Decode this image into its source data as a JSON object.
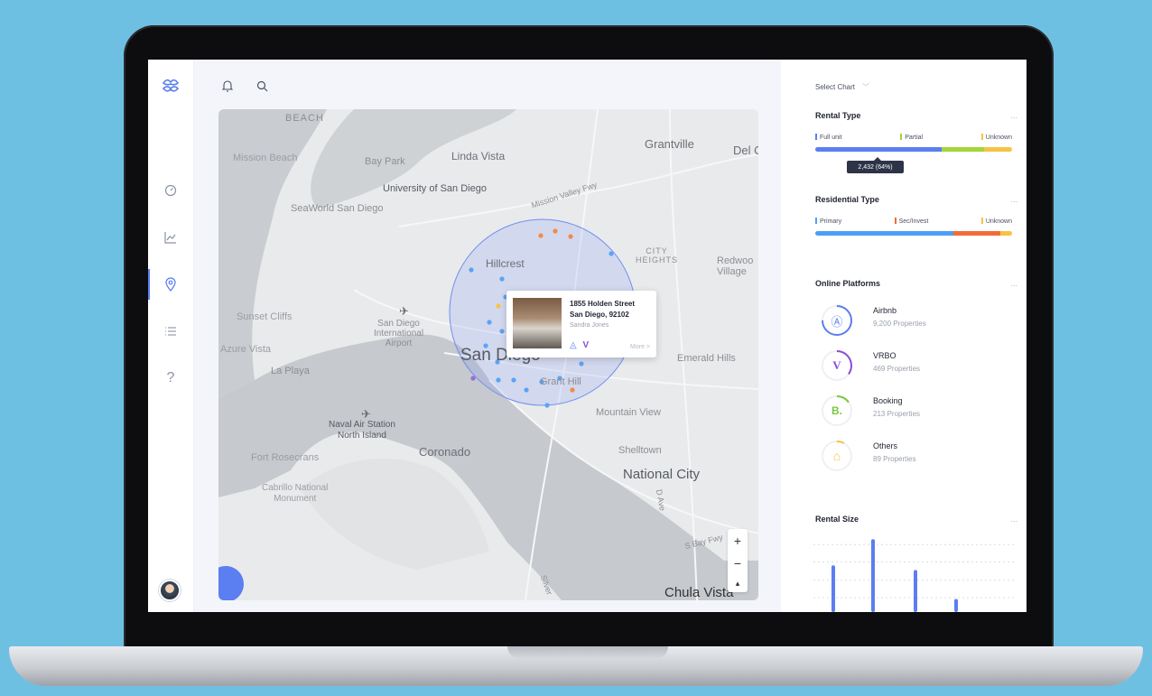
{
  "colors": {
    "accent": "#5b7ef0",
    "full_unit": "#5b7ef0",
    "partial": "#a4d53a",
    "unknown": "#f6c343",
    "primary": "#4d9ef5",
    "sec_invest": "#f26b3a",
    "airbnb": "#5b7ef0",
    "vrbo": "#8c4dd8",
    "booking": "#7cc642",
    "others": "#f6c343"
  },
  "sidebar": {
    "items": [
      {
        "icon": "logo-icon"
      },
      {
        "icon": "dashboard-gauge-icon"
      },
      {
        "icon": "line-chart-icon"
      },
      {
        "icon": "map-pin-icon",
        "active": true
      },
      {
        "icon": "list-icon"
      },
      {
        "icon": "help-icon",
        "glyph": "?"
      }
    ]
  },
  "topbar": {
    "icons": [
      "bell-icon",
      "search-icon"
    ]
  },
  "map": {
    "labels": {
      "beach": "BEACH",
      "mission_beach": "Mission Beach",
      "bay_park": "Bay Park",
      "linda_vista": "Linda Vista",
      "grantville": "Grantville",
      "del": "Del C",
      "university": "University of San Diego",
      "mission_valley_fwy": "Mission Valley Fwy",
      "seaworld": "SeaWorld San Diego",
      "city_heights": "CITY\nHEIGHTS",
      "hillcrest": "Hillcrest",
      "redwood_village": "Redwoo\nVillage",
      "sunset_cliffs": "Sunset Cliffs",
      "airport": "San Diego\nInternational\nAirport",
      "azure_vista": "Azure Vista",
      "san_diego": "San Diego",
      "emerald_hills": "Emerald Hills",
      "la_playa": "La Playa",
      "grant_hill": "Grant Hill",
      "naval_air": "Naval Air Station\nNorth Island",
      "mountain_view": "Mountain View",
      "coronado": "Coronado",
      "shelltown": "Shelltown",
      "fort_rosecrans": "Fort Rosecrans",
      "national_city": "National City",
      "cabrillo": "Cabrillo National\nMonument",
      "s_bay_fwy": "S Bay Fwy",
      "chula_vista": "Chula Vista",
      "d_ave": "D Ave",
      "silver": "Silver"
    },
    "popup": {
      "address_line1": "1855 Holden Street",
      "address_line2": "San Diego, 92102",
      "owner": "Sandra Jones",
      "more": "More >"
    },
    "zoom": {
      "in": "+",
      "out": "−",
      "compass": "▴"
    }
  },
  "panel": {
    "select_chart": "Select Chart",
    "more": "...",
    "rental_type": {
      "title": "Rental Type",
      "legend": [
        "Full unit",
        "Partial",
        "Unknown"
      ],
      "shares": [
        0.64,
        0.22,
        0.14
      ],
      "tooltip": "2,432 (64%)"
    },
    "residential_type": {
      "title": "Residential Type",
      "legend": [
        "Primary",
        "Sec/Invest",
        "Unknown"
      ],
      "shares": [
        0.7,
        0.24,
        0.06
      ]
    },
    "online_platforms": {
      "title": "Online Platforms",
      "items": [
        {
          "name": "Airbnb",
          "count": "9,200 Properties",
          "icon": "airbnb-icon",
          "glyph": "Ⓐ",
          "progress": 0.75
        },
        {
          "name": "VRBO",
          "count": "469 Properties",
          "icon": "vrbo-icon",
          "glyph": "V",
          "progress": 0.35
        },
        {
          "name": "Booking",
          "count": "213 Properties",
          "icon": "booking-icon",
          "glyph": "B.",
          "progress": 0.15
        },
        {
          "name": "Others",
          "count": "89 Properties",
          "icon": "home-icon",
          "glyph": "⌂",
          "progress": 0.08
        }
      ]
    },
    "rental_size": {
      "title": "Rental Size"
    }
  },
  "chart_data": {
    "type": "bar",
    "title": "Rental Size",
    "categories": [
      "",
      "",
      "",
      ""
    ],
    "values": [
      50,
      78,
      45,
      14
    ],
    "ylim": [
      0,
      85
    ],
    "grid": true
  }
}
